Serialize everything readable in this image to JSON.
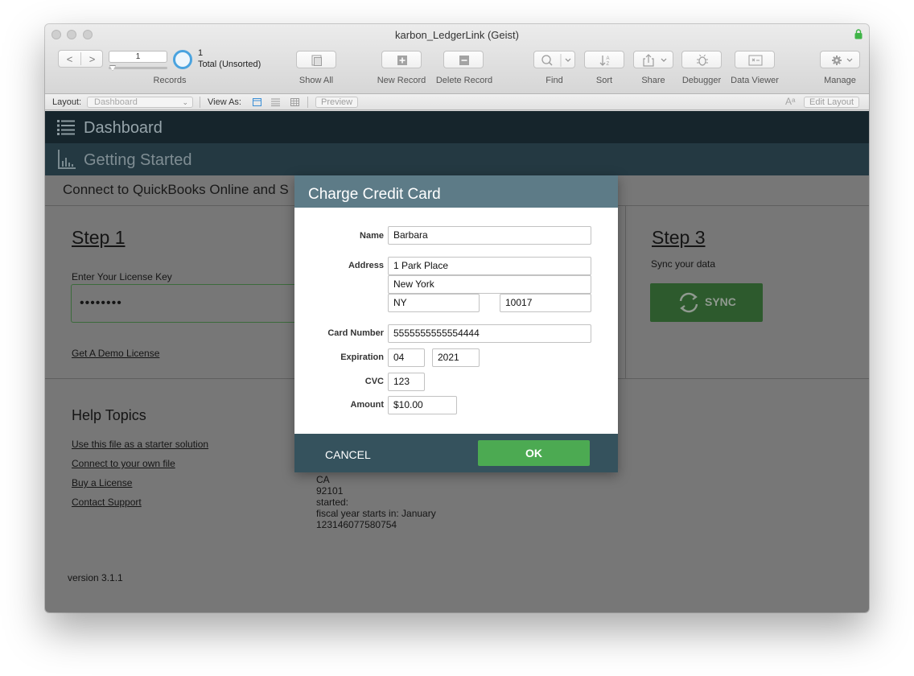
{
  "window": {
    "title": "karbon_LedgerLink (Geist)"
  },
  "toolbar": {
    "record_number": "1",
    "record_count": "1",
    "record_total": "Total (Unsorted)",
    "records_label": "Records",
    "show_all": "Show All",
    "new_record": "New Record",
    "delete_record": "Delete Record",
    "find": "Find",
    "sort": "Sort",
    "share": "Share",
    "debugger": "Debugger",
    "data_viewer": "Data Viewer",
    "manage": "Manage"
  },
  "layout_bar": {
    "layout_label": "Layout:",
    "layout_value": "Dashboard",
    "view_as_label": "View As:",
    "preview": "Preview",
    "edit_layout": "Edit Layout"
  },
  "nav": {
    "dashboard": "Dashboard",
    "getting_started": "Getting Started"
  },
  "main": {
    "connect_text": "Connect to QuickBooks Online and S",
    "step1": {
      "title": "Step 1",
      "license_label": "Enter Your License Key",
      "license_value": "••••••••",
      "demo_link": "Get A Demo License"
    },
    "step3": {
      "title": "Step 3",
      "subtitle": "Sync your data",
      "sync_label": "SYNC"
    },
    "help": {
      "title": "Help Topics",
      "links": [
        "Use this file as a starter solution",
        "Connect to your own file",
        "Buy a License",
        "Contact Support"
      ]
    },
    "under_modal": [
      "CA",
      "92101",
      "started:",
      "fiscal year starts in: January",
      "123146077580754"
    ],
    "version": "version 3.1.1"
  },
  "dialog": {
    "title": "Charge Credit Card",
    "name_label": "Name",
    "name": "Barbara",
    "address_label": "Address",
    "address_line1": "1 Park Place",
    "city": "New York",
    "state": "NY",
    "zip": "10017",
    "card_label": "Card Number",
    "card_number": "5555555555554444",
    "expiration_label": "Expiration",
    "exp_month": "04",
    "exp_year": "2021",
    "cvc_label": "CVC",
    "cvc": "123",
    "amount_label": "Amount",
    "amount": "$10.00",
    "cancel": "CANCEL",
    "ok": "OK"
  },
  "colors": {
    "header_dark": "#16252c",
    "header_mid": "#243942",
    "dialog_header": "#5d7b87",
    "dialog_footer": "#35525d",
    "ok_green": "#4caa52",
    "sync_green": "#2d5a2d"
  }
}
